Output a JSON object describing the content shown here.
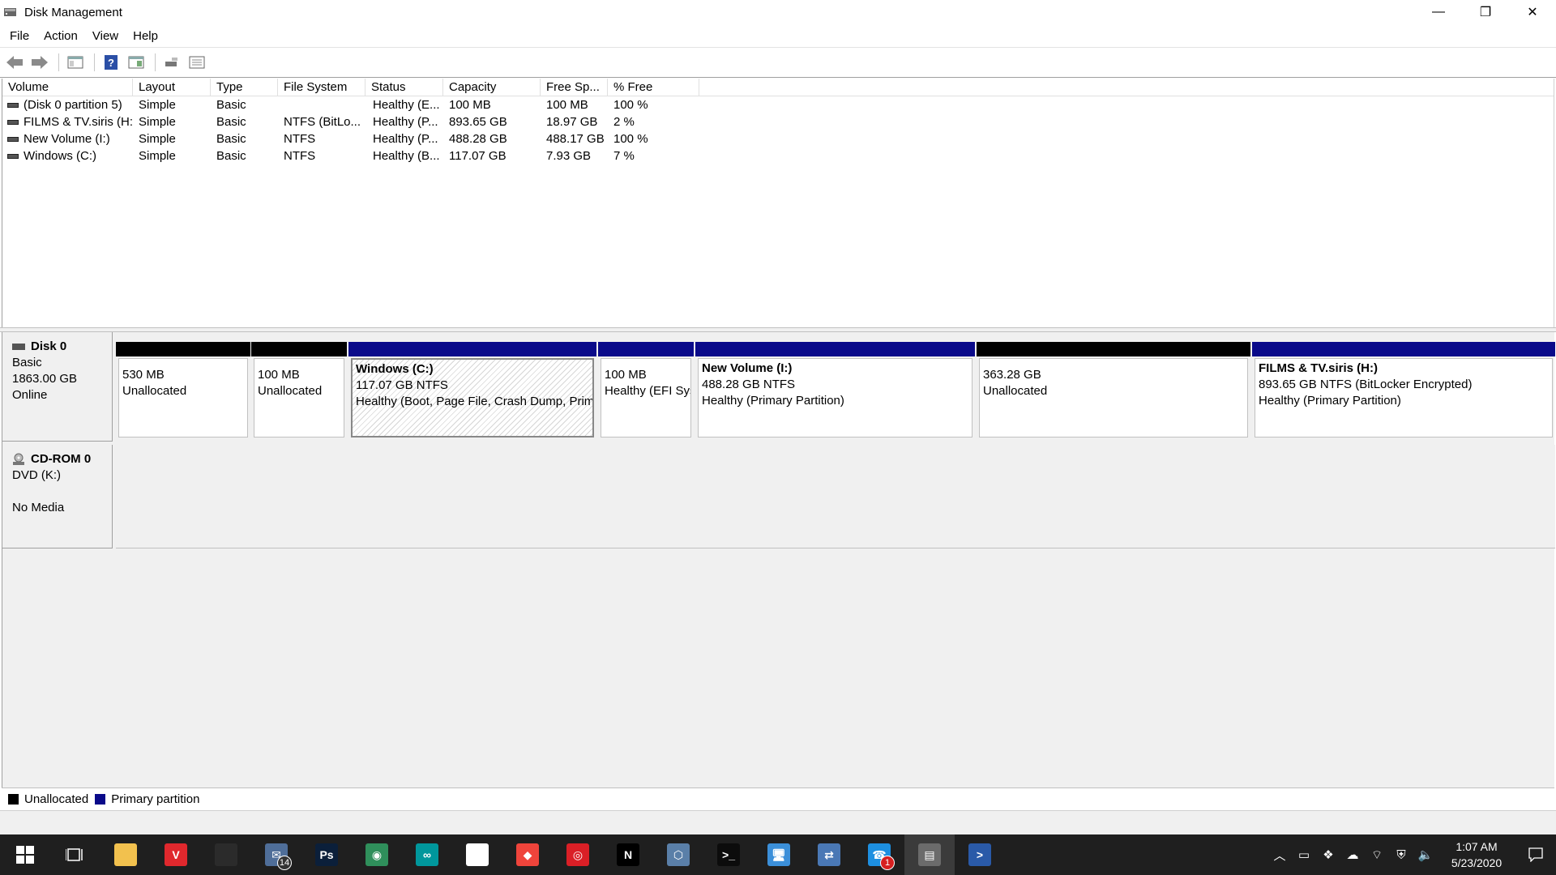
{
  "window": {
    "title": "Disk Management",
    "minimize": "—",
    "restore": "❐",
    "close": "✕"
  },
  "menu": [
    "File",
    "Action",
    "View",
    "Help"
  ],
  "list": {
    "columns": [
      "Volume",
      "Layout",
      "Type",
      "File System",
      "Status",
      "Capacity",
      "Free Sp...",
      "% Free"
    ],
    "rows": [
      {
        "volume": "(Disk 0 partition 5)",
        "layout": "Simple",
        "type": "Basic",
        "fs": "",
        "status": "Healthy (E...",
        "capacity": "100 MB",
        "free": "100 MB",
        "pct": "100 %"
      },
      {
        "volume": "FILMS & TV.siris (H:)",
        "layout": "Simple",
        "type": "Basic",
        "fs": "NTFS (BitLo...",
        "status": "Healthy (P...",
        "capacity": "893.65 GB",
        "free": "18.97 GB",
        "pct": "2 %"
      },
      {
        "volume": "New Volume (I:)",
        "layout": "Simple",
        "type": "Basic",
        "fs": "NTFS",
        "status": "Healthy (P...",
        "capacity": "488.28 GB",
        "free": "488.17 GB",
        "pct": "100 %"
      },
      {
        "volume": "Windows  (C:)",
        "layout": "Simple",
        "type": "Basic",
        "fs": "NTFS",
        "status": "Healthy (B...",
        "capacity": "117.07 GB",
        "free": "7.93 GB",
        "pct": "7 %"
      }
    ]
  },
  "disks": [
    {
      "name": "Disk 0",
      "kind": "Basic",
      "size": "1863.00 GB",
      "state": "Online",
      "partitions": [
        {
          "title": "",
          "line1": "530 MB",
          "line2": "Unallocated",
          "style": "unalloc"
        },
        {
          "title": "",
          "line1": "100 MB",
          "line2": "Unallocated",
          "style": "unalloc"
        },
        {
          "title": "Windows   (C:)",
          "line1": "117.07 GB NTFS",
          "line2": "Healthy (Boot, Page File, Crash Dump, Prima",
          "style": "primary",
          "selected": true
        },
        {
          "title": "",
          "line1": "100 MB",
          "line2": "Healthy (EFI Sys",
          "style": "primary"
        },
        {
          "title": "New Volume  (I:)",
          "line1": "488.28 GB NTFS",
          "line2": "Healthy (Primary Partition)",
          "style": "primary"
        },
        {
          "title": "",
          "line1": "363.28 GB",
          "line2": "Unallocated",
          "style": "unalloc"
        },
        {
          "title": "FILMS & TV.siris  (H:)",
          "line1": "893.65 GB NTFS (BitLocker Encrypted)",
          "line2": "Healthy (Primary Partition)",
          "style": "primary"
        }
      ]
    },
    {
      "name": "CD-ROM 0",
      "kind": "DVD (K:)",
      "size": "",
      "state": "No Media"
    }
  ],
  "legend": [
    {
      "label": "Unallocated",
      "color": "#000000"
    },
    {
      "label": "Primary partition",
      "color": "#0a0a8a"
    }
  ],
  "taskbar": {
    "apps": [
      {
        "name": "file-explorer-icon",
        "color": "#f2c14e",
        "text": ""
      },
      {
        "name": "vivaldi-icon",
        "color": "#e0282d",
        "text": "V"
      },
      {
        "name": "store-icon",
        "color": "#2b2b2b",
        "text": ""
      },
      {
        "name": "mail-icon",
        "color": "#4f6e99",
        "text": "✉",
        "badge": "14"
      },
      {
        "name": "photoshop-icon",
        "color": "#0b1f3a",
        "text": "Ps"
      },
      {
        "name": "maps-icon",
        "color": "#2f8f5b",
        "text": "◉"
      },
      {
        "name": "arduino-icon",
        "color": "#00979c",
        "text": "∞"
      },
      {
        "name": "photos-icon",
        "color": "#ffffff",
        "text": ""
      },
      {
        "name": "anydesk-icon",
        "color": "#ef443b",
        "text": "◆"
      },
      {
        "name": "creative-cloud-icon",
        "color": "#da1f26",
        "text": "◎"
      },
      {
        "name": "netflix-icon",
        "color": "#000000",
        "text": "N"
      },
      {
        "name": "virtualbox-icon",
        "color": "#5a7fa8",
        "text": "⬡"
      },
      {
        "name": "terminal-icon",
        "color": "#0c0c0c",
        "text": ">_"
      },
      {
        "name": "remote-desktop-icon",
        "color": "#3b8fd9",
        "text": "🖥"
      },
      {
        "name": "network-icon",
        "color": "#4a78b5",
        "text": "⇄"
      },
      {
        "name": "chat-icon",
        "color": "#1d8fe0",
        "text": "☎",
        "badge": "1"
      },
      {
        "name": "disk-management-icon",
        "color": "#6b6b6b",
        "text": "▤",
        "active": true
      },
      {
        "name": "powershell-icon",
        "color": "#2a5aa8",
        "text": ">"
      }
    ],
    "time": "1:07 AM",
    "date": "5/23/2020"
  }
}
